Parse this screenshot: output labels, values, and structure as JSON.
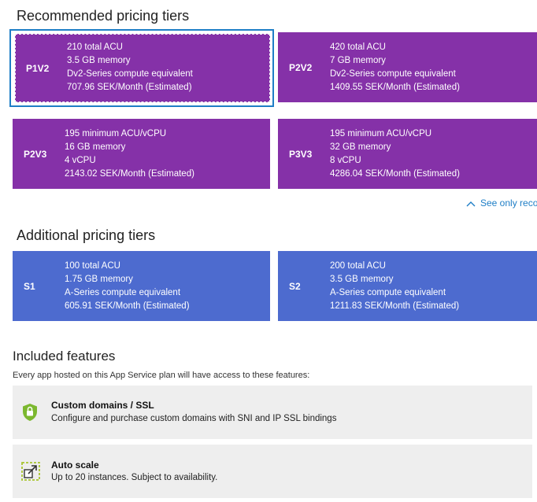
{
  "recommended": {
    "heading": "Recommended pricing tiers",
    "tiers": [
      {
        "code": "P1V2",
        "lines": [
          "210 total ACU",
          "3.5 GB memory",
          "Dv2-Series compute equivalent",
          "707.96 SEK/Month (Estimated)"
        ],
        "selected": true
      },
      {
        "code": "P2V2",
        "lines": [
          "420 total ACU",
          "7 GB memory",
          "Dv2-Series compute equivalent",
          "1409.55 SEK/Month (Estimated)"
        ]
      },
      {
        "code": "P2V3",
        "lines": [
          "195 minimum ACU/vCPU",
          "16 GB memory",
          "4 vCPU",
          "2143.02 SEK/Month (Estimated)"
        ]
      },
      {
        "code": "P3V3",
        "lines": [
          "195 minimum ACU/vCPU",
          "32 GB memory",
          "8 vCPU",
          "4286.04 SEK/Month (Estimated)"
        ]
      }
    ],
    "see_only_label": "See only reco"
  },
  "additional": {
    "heading": "Additional pricing tiers",
    "tiers": [
      {
        "code": "S1",
        "lines": [
          "100 total ACU",
          "1.75 GB memory",
          "A-Series compute equivalent",
          "605.91 SEK/Month (Estimated)"
        ]
      },
      {
        "code": "S2",
        "lines": [
          "200 total ACU",
          "3.5 GB memory",
          "A-Series compute equivalent",
          "1211.83 SEK/Month (Estimated)"
        ]
      }
    ]
  },
  "features": {
    "heading": "Included features",
    "subtitle": "Every app hosted on this App Service plan will have access to these features:",
    "items": [
      {
        "icon": "shield-lock-icon",
        "title": "Custom domains / SSL",
        "description": "Configure and purchase custom domains with SNI and IP SSL bindings"
      },
      {
        "icon": "auto-scale-icon",
        "title": "Auto scale",
        "description": "Up to 20 instances. Subject to availability."
      }
    ]
  },
  "colors": {
    "premium_tier": "#8531a8",
    "standard_tier": "#4d6bcf",
    "selection_border": "#1e7ec6",
    "link": "#1e7ec6",
    "feature_bg": "#eeeeee"
  }
}
